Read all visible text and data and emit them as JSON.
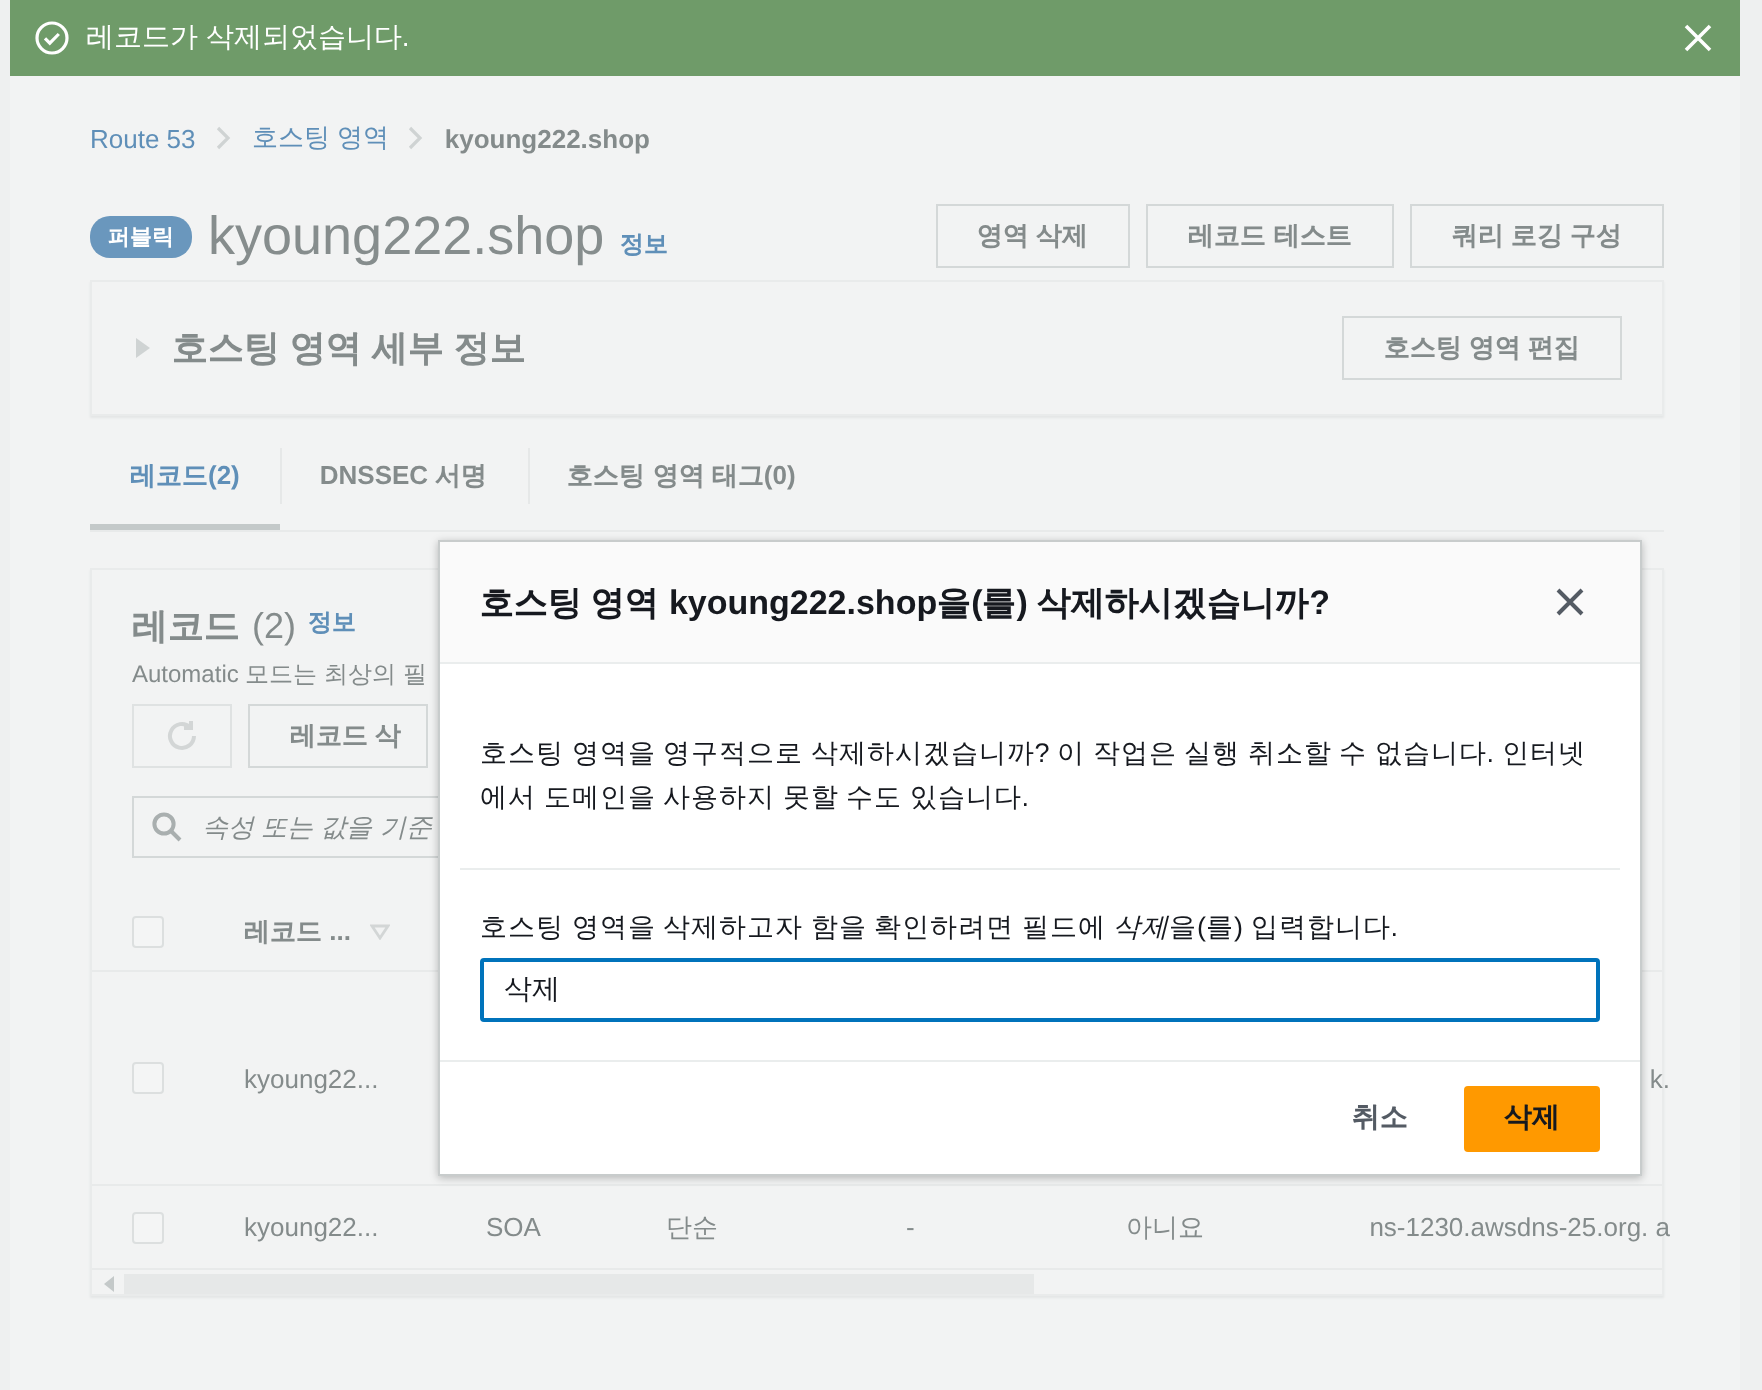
{
  "notification": {
    "message": "레코드가 삭제되었습니다."
  },
  "breadcrumbs": [
    {
      "label": "Route 53",
      "current": false
    },
    {
      "label": "호스팅 영역",
      "current": false
    },
    {
      "label": "kyoung222.shop",
      "current": true
    }
  ],
  "header": {
    "badge": "퍼블릭",
    "title": "kyoung222.shop",
    "info": "정보",
    "buttons": [
      "영역 삭제",
      "레코드 테스트",
      "쿼리 로깅 구성"
    ]
  },
  "details_panel": {
    "title": "호스팅 영역 세부 정보",
    "expanded": false,
    "button": "호스팅 영역 편집"
  },
  "tabs": [
    {
      "label": "레코드(2)",
      "selected": true
    },
    {
      "label": "DNSSEC 서명",
      "selected": false
    },
    {
      "label": "호스팅 영역 태그(0)",
      "selected": false
    }
  ],
  "records_panel": {
    "title": "레코드",
    "count": "(2)",
    "info": "정보",
    "description": "Automatic 모드는 최상의 필",
    "delete_button": "레코드 삭",
    "search": {
      "placeholder": "속성 또는 값을 기준"
    },
    "table": {
      "select_all_checked": false,
      "columns": [
        "레코드 ..."
      ],
      "rows": [
        {
          "selected": false,
          "column_1": "kyoung22...",
          "column_6": "k."
        },
        {
          "selected": false,
          "column_1": "kyoung22...",
          "column_2": "SOA",
          "column_3": "단순",
          "column_4": "-",
          "column_5": "아니요",
          "column_6": "ns-1230.awsdns-25.org. a"
        }
      ]
    }
  },
  "dialog": {
    "title": "호스팅 영역 kyoung222.shop을(를) 삭제하시겠습니까?",
    "message": "호스팅 영역을 영구적으로 삭제하시겠습니까? 이 작업은 실행 취소할 수 없습니다. 인터넷에서 도메인을 사용하지 못할 수도 있습니다.",
    "confirm_label": [
      {
        "text": "호스팅 영역을 삭제하고자 함을 확인하려면 필드에 ",
        "italic": false
      },
      {
        "text": "삭제",
        "italic": true
      },
      {
        "text": "을(를) 입력합니다.",
        "italic": false
      }
    ],
    "input": {
      "value": "삭제"
    },
    "buttons": [
      {
        "label": "취소",
        "kind": "link"
      },
      {
        "label": "삭제",
        "kind": "primary"
      }
    ]
  }
}
